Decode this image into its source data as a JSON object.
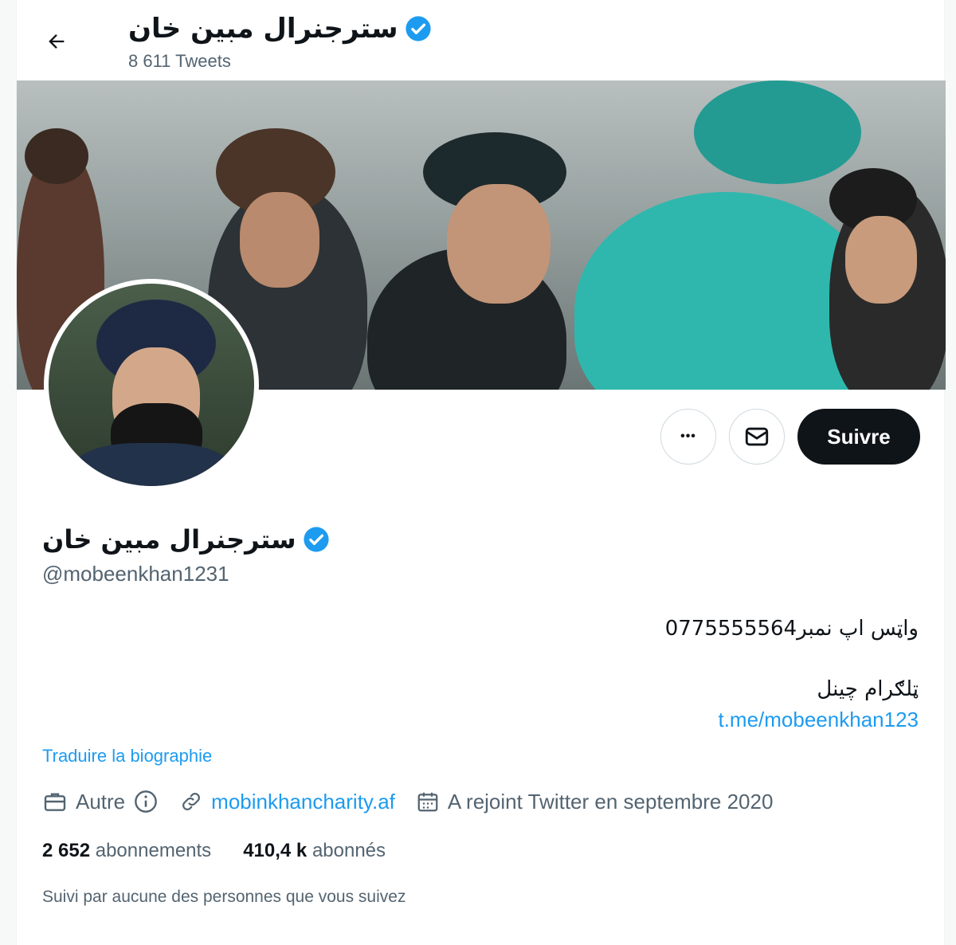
{
  "header": {
    "name": "سترجنرال مبین خان",
    "tweet_count": "8 611 Tweets"
  },
  "profile": {
    "display_name": "سترجنرال مبین خان",
    "handle": "@mobeenkhan1231",
    "bio_line1": "واټس اپ نمبر0775555564",
    "bio_line2": "ټلګرام چینل",
    "bio_link": "t.me/mobeenkhan123",
    "translate_label": "Traduire la biographie",
    "category": "Autre",
    "website": "mobinkhancharity.af",
    "joined": "A rejoint Twitter en septembre 2020",
    "following_count": "2 652",
    "following_label": "abonnements",
    "followers_count": "410,4 k",
    "followers_label": "abonnés",
    "followed_by": "Suivi par aucune des personnes que vous suivez"
  },
  "actions": {
    "more_label": "•••",
    "follow_label": "Suivre"
  },
  "colors": {
    "accent": "#1d9bf0",
    "text": "#0f1419",
    "muted": "#536471",
    "verified": "#1d9bf0"
  }
}
